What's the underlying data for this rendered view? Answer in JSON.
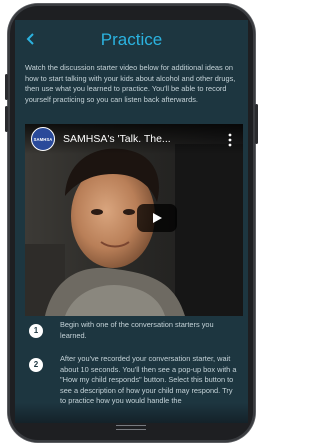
{
  "header": {
    "title": "Practice",
    "back_icon": "chevron-left-icon"
  },
  "intro": {
    "text": "Watch the discussion starter video below for additional ideas on how to start talking with your kids about alcohol and other drugs, then use what you learned to practice. You'll be able to record yourself practicing so you can listen back afterwards."
  },
  "video": {
    "channel_logo_text": "SAMHSA",
    "title": "SAMHSA's 'Talk. The...",
    "more_icon": "more-vertical-icon",
    "play_icon": "play-icon"
  },
  "steps": [
    {
      "number": "1",
      "text": "Begin with one of the conversation starters you learned."
    },
    {
      "number": "2",
      "text": "After you've recorded your conversation starter, wait about 10 seconds. You'll then see a pop-up box with a \"How my child responds\" button. Select this button to see a description of how your child may respond. Try to practice how you would handle the"
    }
  ],
  "colors": {
    "screen_bg": "#1d3640",
    "accent": "#2bb3e0",
    "body_text": "#c5d3d8"
  }
}
